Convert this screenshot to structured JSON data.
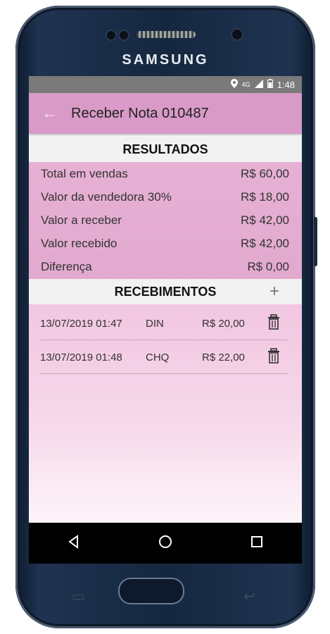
{
  "device": {
    "brand": "SAMSUNG"
  },
  "status_bar": {
    "time": "1:48",
    "network": "4G"
  },
  "app_bar": {
    "title": "Receber Nota 010487"
  },
  "results": {
    "header": "RESULTADOS",
    "rows": [
      {
        "label": "Total em vendas",
        "value": "R$ 60,00"
      },
      {
        "label": "Valor da vendedora 30%",
        "value": "R$ 18,00"
      },
      {
        "label": "Valor a receber",
        "value": "R$ 42,00"
      },
      {
        "label": "Valor recebido",
        "value": "R$ 42,00"
      },
      {
        "label": "Diferença",
        "value": "R$ 0,00"
      }
    ]
  },
  "receipts": {
    "header": "RECEBIMENTOS",
    "add_label": "+",
    "items": [
      {
        "date": "13/07/2019 01:47",
        "type": "DIN",
        "value": "R$ 20,00"
      },
      {
        "date": "13/07/2019 01:48",
        "type": "CHQ",
        "value": "R$ 22,00"
      }
    ]
  },
  "colors": {
    "app_bar": "#d99ac8",
    "results_bg": "#e6b0d4",
    "status_bar": "#7a7a7a"
  }
}
